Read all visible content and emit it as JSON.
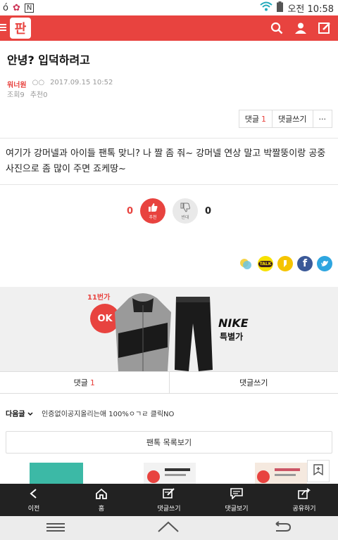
{
  "status": {
    "time": "오전 10:58",
    "left_icons": [
      "ó",
      "✿",
      "N"
    ]
  },
  "header": {
    "logo_text": "판"
  },
  "post": {
    "title": "안녕? 입덕하려고",
    "author": "워너원",
    "level": "○○",
    "date": "2017.09.15 10:52",
    "views": "조회9",
    "recommends": "추천0",
    "comment_label": "댓글",
    "comment_count": "1",
    "write_comment": "댓글쓰기",
    "more": "···",
    "body": "여기가 강머넬과 아이들 팬톡 맞니? 나 짤 좀 줘~ 강머넬 연상 말고 박짤뚱이랑 공중 사진으로 좀 많이 주면 죠케땅~"
  },
  "votes": {
    "up_count": "0",
    "up_label": "추천",
    "down_count": "0",
    "down_label": "반대"
  },
  "share": {
    "talk_label": "TALK"
  },
  "ad": {
    "badge": "11번가",
    "ok_label": "OK",
    "brand": "NIKE",
    "brand_sub": "특별가"
  },
  "comment_bar": {
    "label": "댓글",
    "count": "1",
    "write": "댓글쓰기"
  },
  "next_post": {
    "label": "다음글",
    "title": "인증없이공지올리는애 100%ㅇㄱㄹ 클릭NO"
  },
  "list_button": "팬톡 목록보기",
  "bottom_nav": [
    {
      "label": "이전",
      "icon": "back-icon"
    },
    {
      "label": "홈",
      "icon": "home-icon"
    },
    {
      "label": "댓글쓰기",
      "icon": "write-comment-icon"
    },
    {
      "label": "댓글보기",
      "icon": "view-comments-icon"
    },
    {
      "label": "공유하기",
      "icon": "share-icon"
    }
  ],
  "colors": {
    "accent": "#e8433f",
    "nav_bg": "#222222"
  }
}
